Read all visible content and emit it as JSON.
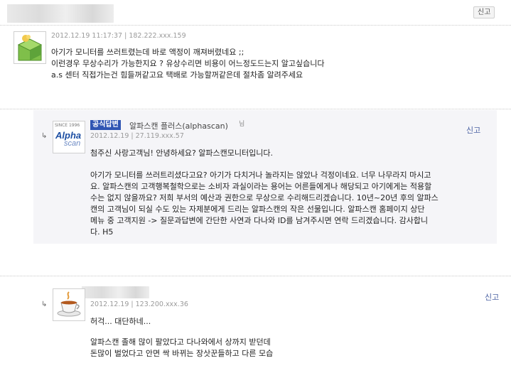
{
  "top_report_label": "신고",
  "question": {
    "meta": "2012.12.19 11:17:37 | 182.222.xxx.159",
    "lines": [
      "아기가 모니터를 쓰러트렸는데 바로 액정이 깨져버렸네요 ;;",
      "이런경우 무상수리가 가능한지요 ? 유상수리면 비용이 어느정도드는지 알고싶습니다",
      "a.s 센터 직접가는건 힘들꺼같고요 택배로 가능할꺼같은데 절차좀 알려주세요"
    ]
  },
  "answer": {
    "badge": "공식답변",
    "name": "알파스캔 플러스(alphascan)",
    "name_suffix": "님",
    "meta": "2012.12.19 | 27.119.xxx.57",
    "report_label": "신고",
    "logo_top": "Alpha",
    "logo_bottom": "scan",
    "logo_small": "SINCE 1996",
    "greeting": "첨주신 사랑고객님! 안녕하세요? 알파스캔모니터입니다.",
    "lines": [
      "아기가 모니터를 쓰러트리셨다고요? 아기가 다치거나 놀라지는 않았나 걱정이네요. 너무 나무라지 마시고",
      "요. 알파스캔의 고객행복철학으로는 소비자 과실이라는 용어는 어른들에게나 해당되고 아기에게는 적용할",
      "수는 없지 않을까요? 저희 부서의 예산과 권한으로 무상으로 수리해드리겠습니다. 10년~20년 후의 알파스",
      "캔의 고객님이 되실 수도 있는 자제분에게 드리는 알파스캔의 작은 선물입니다. 알파스캔 홈페이지 상단",
      "메뉴 중 고객지원 -> 질문과답변에 간단한 사연과 다나와 ID를 남겨주시면 연락 드리겠습니다. 감사합니",
      "다. H5"
    ]
  },
  "reply": {
    "meta": "2012.12.19 | 123.200.xxx.36",
    "report_label": "신고",
    "lines1": [
      "허걱... 대단하네..."
    ],
    "lines2": [
      "알파스캔 졸해 많이 팔았다고 다나와에서 상까지 받던데",
      "돈많이 벌었다고 안면 싹 바뀌는 장삿꾼들하고 다른 모습"
    ]
  },
  "colors": {
    "badge": "#2f55b3",
    "report_link": "#4b62a3",
    "answer_bg": "#f5f5f8"
  }
}
